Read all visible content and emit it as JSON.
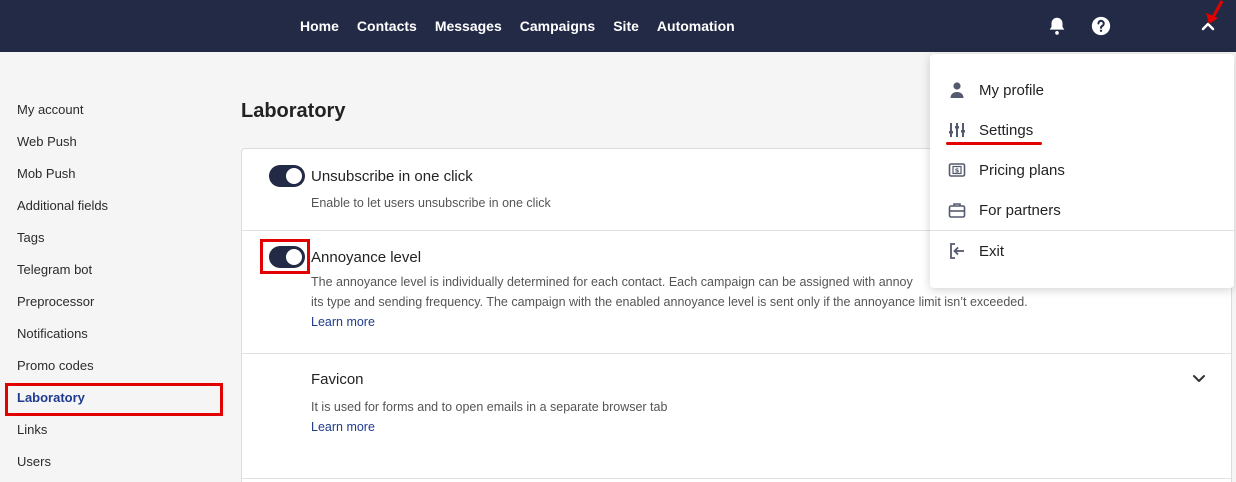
{
  "nav": {
    "items": [
      "Home",
      "Contacts",
      "Messages",
      "Campaigns",
      "Site",
      "Automation"
    ]
  },
  "icons": {
    "bell": "bell-icon",
    "help": "help-icon",
    "chevron": "chevron-up-icon"
  },
  "sidebar": {
    "items": [
      {
        "label": "My account"
      },
      {
        "label": "Web Push"
      },
      {
        "label": "Mob Push"
      },
      {
        "label": "Additional fields"
      },
      {
        "label": "Tags"
      },
      {
        "label": "Telegram bot"
      },
      {
        "label": "Preprocessor"
      },
      {
        "label": "Notifications"
      },
      {
        "label": "Promo codes"
      },
      {
        "label": "Laboratory",
        "active": true
      },
      {
        "label": "Links"
      },
      {
        "label": "Users"
      }
    ]
  },
  "main": {
    "title": "Laboratory",
    "options": [
      {
        "title": "Unsubscribe in one click",
        "desc": "Enable to let users unsubscribe in one click",
        "enabled": true
      },
      {
        "title": "Annoyance level",
        "desc_line1": "The annoyance level is individually determined for each contact. Each campaign can be assigned with annoy",
        "desc_line2": "its type and sending frequency. The campaign with the enabled annoyance level is sent only if the annoyance limit isn’t exceeded.",
        "link": "Learn more",
        "enabled": true
      },
      {
        "title": "Favicon",
        "desc": "It is used for forms and to open emails in a separate browser tab",
        "link": "Learn more"
      }
    ]
  },
  "dropdown": {
    "items": [
      {
        "label": "My profile",
        "icon": "user-icon"
      },
      {
        "label": "Settings",
        "icon": "sliders-icon"
      },
      {
        "label": "Pricing plans",
        "icon": "pricing-icon"
      },
      {
        "label": "For partners",
        "icon": "briefcase-icon"
      },
      {
        "label": "Exit",
        "icon": "exit-icon"
      }
    ]
  },
  "colors": {
    "topbar": "#232a45",
    "accent": "#1f3b8f",
    "highlight": "#e30000"
  }
}
